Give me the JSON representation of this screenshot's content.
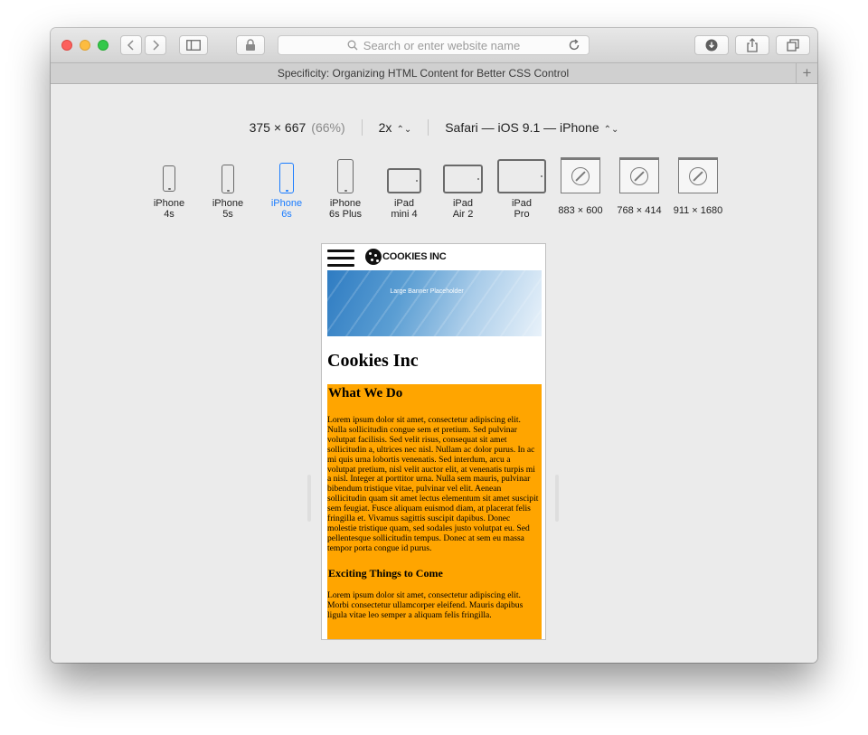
{
  "browser": {
    "search_placeholder": "Search or enter website name",
    "tab_title": "Specificity: Organizing HTML Content for Better CSS Control",
    "new_tab_symbol": "+"
  },
  "responsive": {
    "dimensions": "375 × 667",
    "zoom": "(66%)",
    "pixel_ratio": "2x",
    "user_agent": "Safari — iOS 9.1 — iPhone",
    "devices": [
      {
        "line1": "iPhone",
        "line2": "4s",
        "icon": "phone-icon"
      },
      {
        "line1": "iPhone",
        "line2": "5s",
        "icon": "phone-icon"
      },
      {
        "line1": "iPhone",
        "line2": "6s",
        "icon": "phone-icon",
        "active": true
      },
      {
        "line1": "iPhone",
        "line2": "6s Plus",
        "icon": "phone-icon"
      },
      {
        "line1": "iPad",
        "line2": "mini 4",
        "icon": "tablet-icon"
      },
      {
        "line1": "iPad",
        "line2": "Air 2",
        "icon": "tablet-icon"
      },
      {
        "line1": "iPad",
        "line2": "Pro",
        "icon": "tablet-icon"
      },
      {
        "line1": "883 × 600",
        "icon": "browser-window-icon"
      },
      {
        "line1": "768 × 414",
        "icon": "browser-window-icon"
      },
      {
        "line1": "911 × 1680",
        "icon": "browser-window-icon"
      }
    ],
    "accent_color": "#1a7cff"
  },
  "site": {
    "logo_text": "COOKIES INC",
    "banner_text": "Large Banner Placeholder",
    "title": "Cookies Inc",
    "section_heading": "What We Do",
    "section_body": "Lorem ipsum dolor sit amet, consectetur adipiscing elit. Nulla sollicitudin congue sem et pretium. Sed pulvinar volutpat facilisis. Sed velit risus, consequat sit amet sollicitudin a, ultrices nec nisl. Nullam ac dolor purus. In ac mi quis urna lobortis venenatis. Sed interdum, arcu a volutpat pretium, nisl velit auctor elit, at venenatis turpis mi a nisl. Integer at porttitor urna. Nulla sem mauris, pulvinar bibendum tristique vitae, pulvinar vel elit. Aenean sollicitudin quam sit amet lectus elementum sit amet suscipit sem feugiat. Fusce aliquam euismod diam, at placerat felis fringilla et. Vivamus sagittis suscipit dapibus. Donec molestie tristique quam, sed sodales justo volutpat eu. Sed pellentesque sollicitudin tempus. Donec at sem eu massa tempor porta congue id purus.",
    "sub_heading": "Exciting Things to Come",
    "sub_body": "Lorem ipsum dolor sit amet, consectetur adipiscing elit. Morbi consectetur ullamcorper eleifend. Mauris dapibus ligula vitae leo semper a aliquam felis fringilla.",
    "section_color": "#ffa500"
  }
}
